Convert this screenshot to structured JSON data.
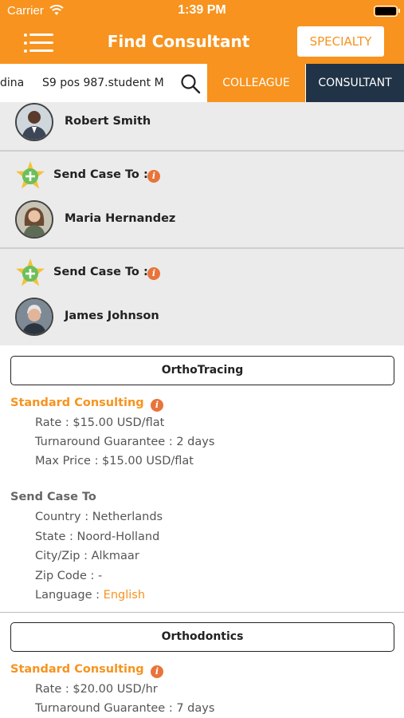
{
  "status_bar": {
    "carrier": "Carrier",
    "time": "1:39 PM"
  },
  "navbar": {
    "title": "Find Consultant",
    "specialty_label": "SPECIALTY"
  },
  "search": {
    "text_left": "dina",
    "text_main": "S9 pos 987.student M"
  },
  "tabs": {
    "colleague": "COLLEAGUE",
    "consultant": "CONSULTANT"
  },
  "consultants": [
    {
      "name": "Robert Smith"
    },
    {
      "send_case_label": "Send Case To :",
      "name": "Maria Hernandez"
    },
    {
      "send_case_label": "Send Case To :",
      "name": "James Johnson"
    }
  ],
  "sections": [
    {
      "title": "OrthoTracing",
      "consulting_title": "Standard Consulting",
      "rate": "Rate : $15.00 USD/flat",
      "turnaround": "Turnaround  Guarantee : 2 days",
      "max_price": "Max Price : $15.00 USD/flat",
      "send_case_to": {
        "title": "Send Case To",
        "country": "Country : Netherlands",
        "state": "State : Noord-Holland",
        "city": "City/Zip : Alkmaar",
        "zip": "Zip Code : -",
        "language_label": "Language : ",
        "language_value": "English"
      }
    },
    {
      "title": "Orthodontics",
      "consulting_title": "Standard Consulting",
      "rate": "Rate : $20.00 USD/hr",
      "turnaround": "Turnaround  Guarantee : 7 days"
    }
  ],
  "icons": {
    "menu": "hamburger-menu-icon",
    "search": "search-icon",
    "star": "star-plus-icon",
    "info": "info-icon",
    "wifi": "wifi-icon",
    "battery": "battery-icon"
  },
  "colors": {
    "accent": "#f7931e",
    "dark_tab": "#213346",
    "list_bg": "#ebebeb",
    "info": "#e8743b"
  }
}
